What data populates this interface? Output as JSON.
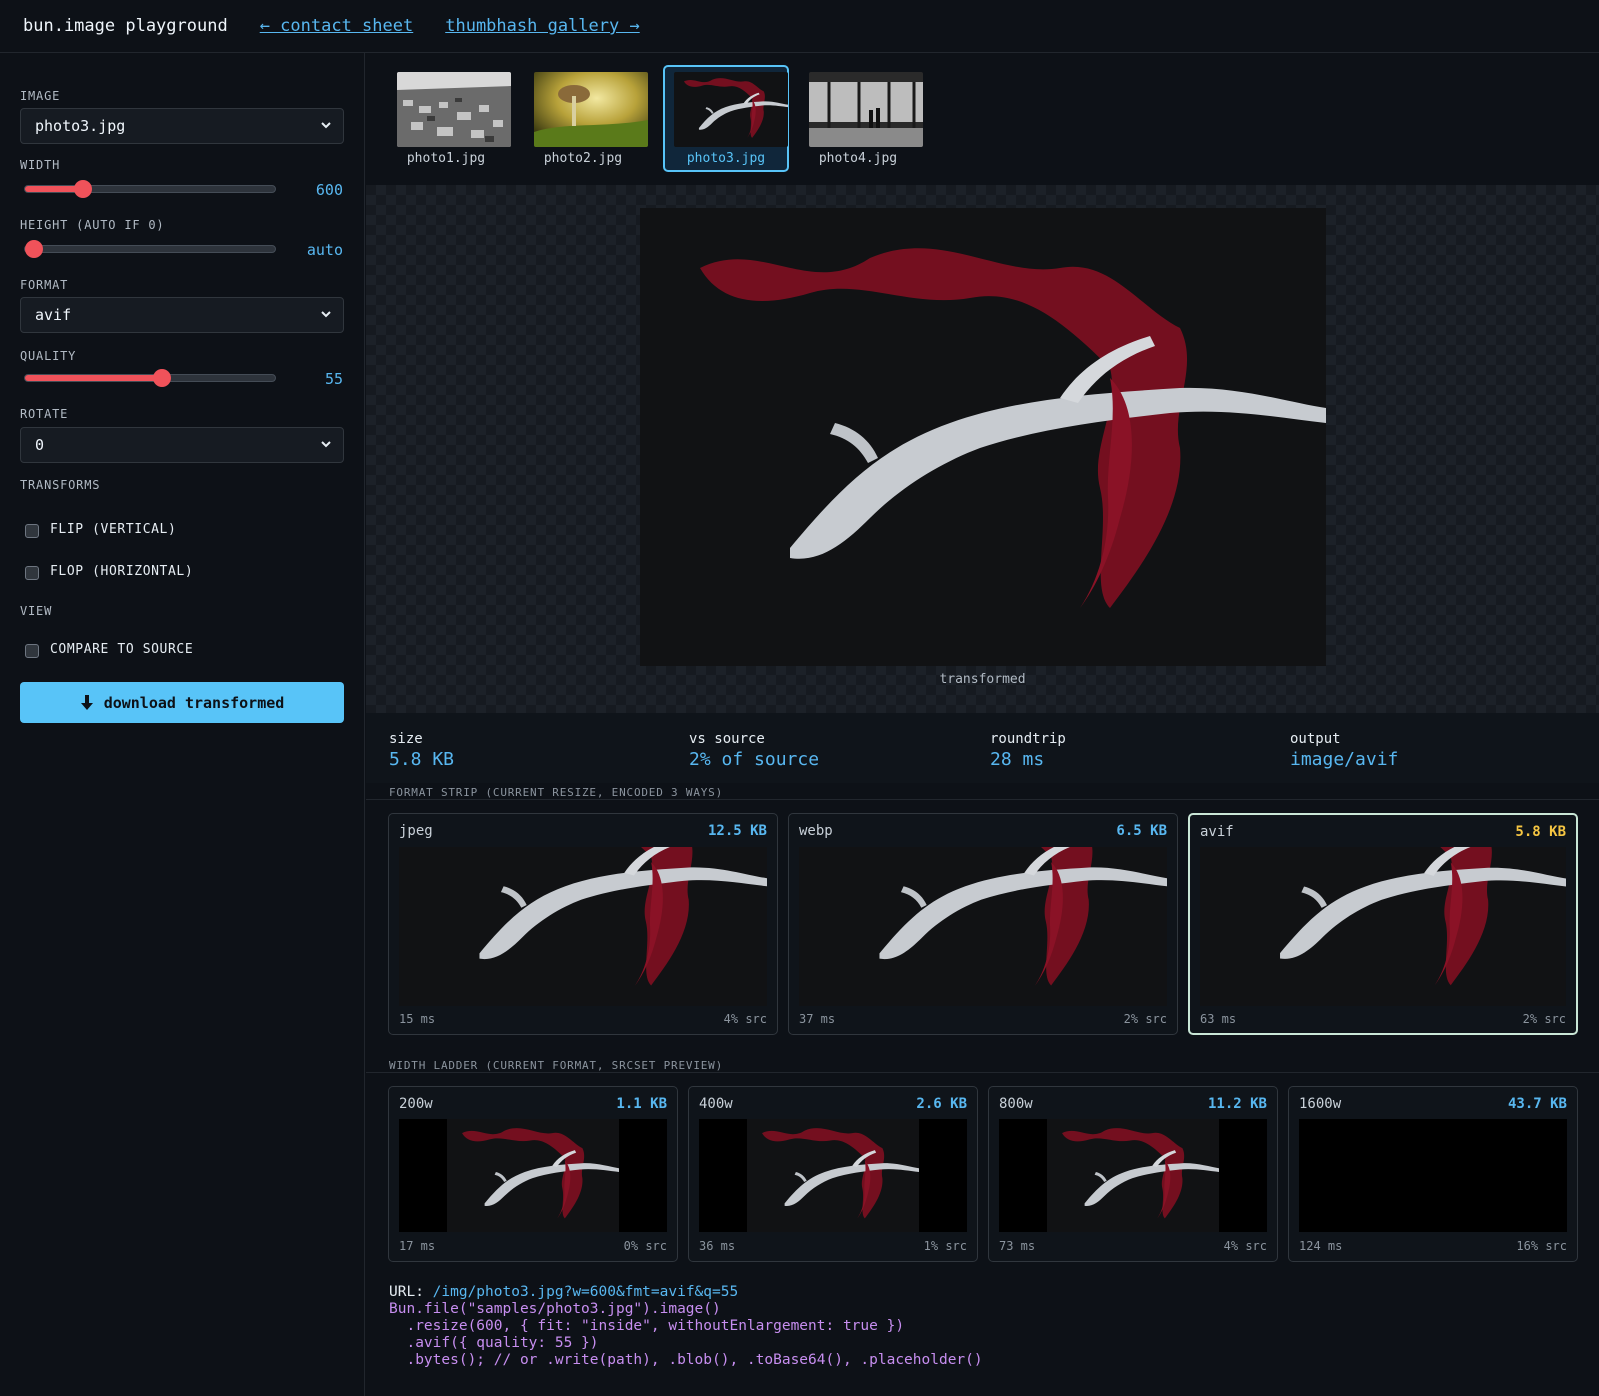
{
  "header": {
    "title": "bun.image playground",
    "link_contact": "← contact sheet",
    "link_gallery": "thumbhash gallery →"
  },
  "sidebar": {
    "image_label": "IMAGE",
    "image_value": "photo3.jpg",
    "width_label": "WIDTH",
    "width_value": "600",
    "width_fraction": 0.21,
    "height_label": "HEIGHT (AUTO IF 0)",
    "height_value": "auto",
    "height_fraction": 0.0,
    "format_label": "FORMAT",
    "format_value": "avif",
    "quality_label": "QUALITY",
    "quality_value": "55",
    "quality_fraction": 0.55,
    "rotate_label": "ROTATE",
    "rotate_value": "0",
    "transforms_label": "TRANSFORMS",
    "flip_label": "FLIP (VERTICAL)",
    "flop_label": "FLOP (HORIZONTAL)",
    "view_label": "VIEW",
    "compare_label": "COMPARE TO SOURCE",
    "download_label": "download transformed",
    "accent_color": "#58c4f8",
    "slider_color": "#f0525a"
  },
  "thumbnails": [
    {
      "caption": "photo1.jpg",
      "selected": false
    },
    {
      "caption": "photo2.jpg",
      "selected": false
    },
    {
      "caption": "photo3.jpg",
      "selected": true
    },
    {
      "caption": "photo4.jpg",
      "selected": false
    }
  ],
  "viewer": {
    "caption": "transformed"
  },
  "stats": {
    "size_label": "size",
    "size_value": "5.8 KB",
    "vs_label": "vs source",
    "vs_value": "2% of source",
    "roundtrip_label": "roundtrip",
    "roundtrip_value": "28 ms",
    "output_label": "output",
    "output_value": "image/avif"
  },
  "format_strip": {
    "label": "FORMAT STRIP (CURRENT RESIZE, ENCODED 3 WAYS)",
    "cards": [
      {
        "name": "jpeg",
        "size": "12.5 KB",
        "ms": "15 ms",
        "pct": "4% src",
        "selected": false
      },
      {
        "name": "webp",
        "size": "6.5 KB",
        "ms": "37 ms",
        "pct": "2% src",
        "selected": false
      },
      {
        "name": "avif",
        "size": "5.8 KB",
        "ms": "63 ms",
        "pct": "2% src",
        "selected": true
      }
    ]
  },
  "width_ladder": {
    "label": "WIDTH LADDER (CURRENT FORMAT, SRCSET PREVIEW)",
    "cards": [
      {
        "name": "200w",
        "size": "1.1 KB",
        "ms": "17 ms",
        "pct": "0% src"
      },
      {
        "name": "400w",
        "size": "2.6 KB",
        "ms": "36 ms",
        "pct": "1% src"
      },
      {
        "name": "800w",
        "size": "11.2 KB",
        "ms": "73 ms",
        "pct": "4% src"
      },
      {
        "name": "1600w",
        "size": "43.7 KB",
        "ms": "124 ms",
        "pct": "16% src"
      }
    ]
  },
  "code": {
    "url_key": "URL:",
    "url_value": "/img/photo3.jpg?w=600&fmt=avif&q=55",
    "line1": "Bun.file(\"samples/photo3.jpg\").image()",
    "line2": "  .resize(600, { fit: \"inside\", withoutEnlargement: true })",
    "line3": "  .avif({ quality: 55 })",
    "line4": "  .bytes(); // or .write(path), .blob(), .toBase64(), .placeholder()"
  }
}
